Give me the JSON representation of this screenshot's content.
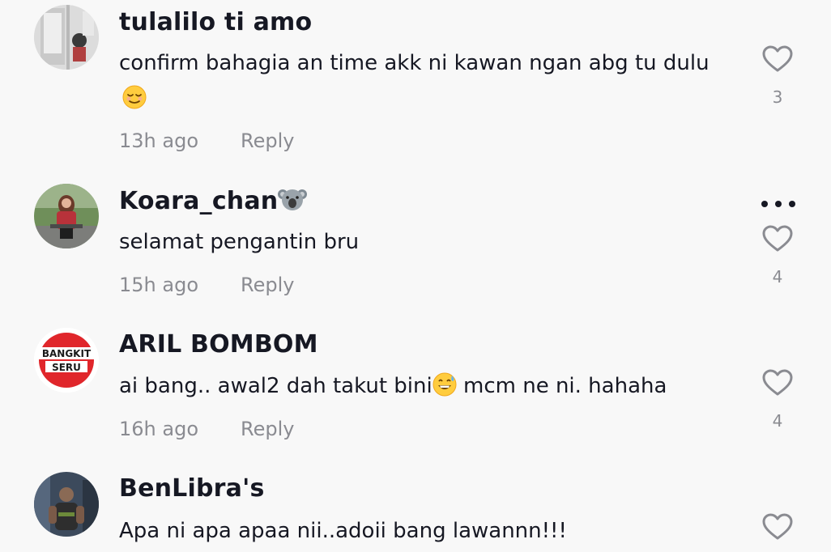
{
  "comments": [
    {
      "username": "tulalilo ti amo",
      "text": "confirm bahagia an time akk ni kawan ngan abg tu dulu",
      "emoji": "relieved-face",
      "time": "13h ago",
      "reply_label": "Reply",
      "likes": "3"
    },
    {
      "username": "Koara_chan",
      "username_emoji": "koala",
      "text": "selamat pengantin bru",
      "time": "15h ago",
      "reply_label": "Reply",
      "likes": "4"
    },
    {
      "username": "ARIL BOMBOM",
      "text_before": "ai bang.. awal2 dah takut bini",
      "text_emoji": "grinning-face-with-sweat",
      "text_after": " mcm ne ni. hahaha",
      "avatar_text_top": "BANGKIT",
      "avatar_text_bottom": "SERU",
      "time": "16h ago",
      "reply_label": "Reply",
      "likes": "4"
    },
    {
      "username": "BenLibra's",
      "text": "Apa ni apa apaa nii..adoii bang lawannn!!!"
    }
  ],
  "colors": {
    "background": "#f8f8f8",
    "primary_text": "#161823",
    "secondary_text": "#8a8b91",
    "aril_avatar_red": "#e0262b"
  },
  "icons": {
    "like": "heart-outline-icon",
    "more": "more-options-icon"
  }
}
